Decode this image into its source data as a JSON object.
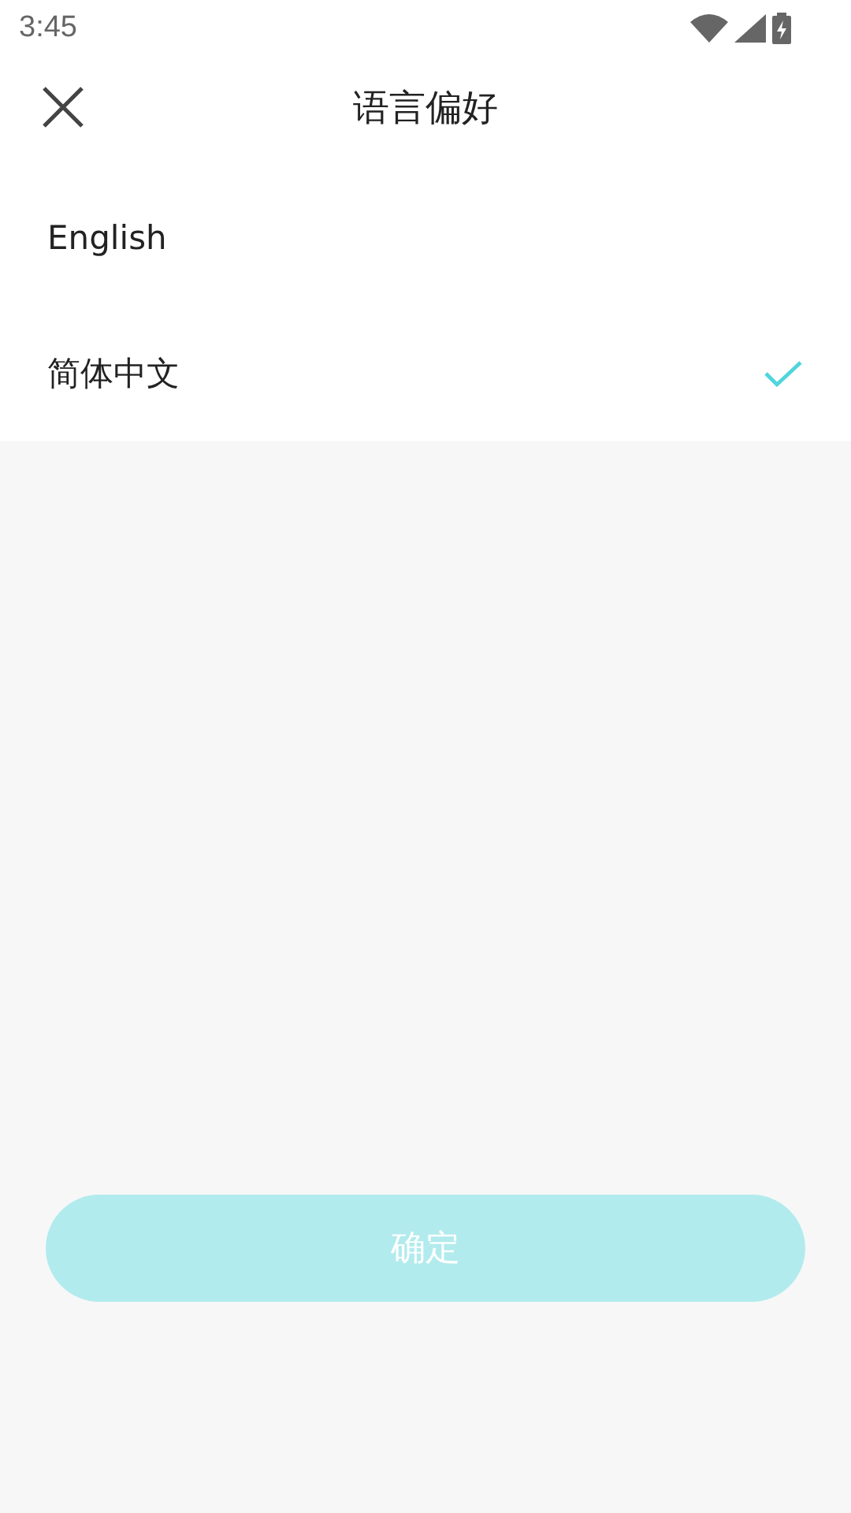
{
  "status_bar": {
    "time": "3:45"
  },
  "header": {
    "title": "语言偏好"
  },
  "languages": [
    {
      "label": "English",
      "selected": false
    },
    {
      "label": "简体中文",
      "selected": true
    }
  ],
  "confirm_button": {
    "label": "确定",
    "disabled": true
  }
}
